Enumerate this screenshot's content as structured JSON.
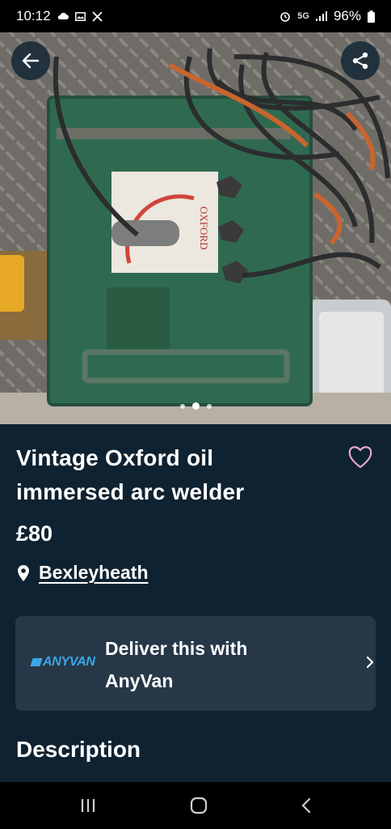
{
  "status_bar": {
    "time": "10:12",
    "left_icons": [
      "cloud-icon",
      "gallery-icon",
      "tools-icon"
    ],
    "right_icons": [
      "alarm-icon",
      "5g-icon",
      "signal-icon",
      "battery-icon"
    ],
    "network": "5G",
    "battery": "96%"
  },
  "gallery": {
    "image_count": 3,
    "active_index": 1,
    "dial_brand": "OXFORD"
  },
  "listing": {
    "title": "Vintage Oxford oil immersed arc welder",
    "price": "£80",
    "location": "Bexleyheath"
  },
  "delivery": {
    "brand_logo": "ANYVAN",
    "text": "Deliver this with AnyVan"
  },
  "description": {
    "heading": "Description"
  },
  "colors": {
    "background": "#0f2231",
    "card": "#263848",
    "favorite_outline": "#e8a7d6",
    "anyvan_blue": "#3aa6e9"
  }
}
